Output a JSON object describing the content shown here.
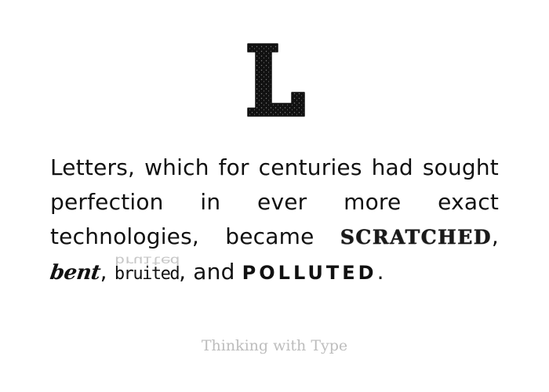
{
  "drop_cap": "L",
  "quote": {
    "part1": "Letters, which for centuries had sought perfection in ever more exact technologies, became ",
    "scratched": "SCRATCHED",
    "sep1": ", ",
    "bent": "bent",
    "sep2": ", ",
    "bruited": "bruited",
    "sep3": ", and ",
    "polluted": "POLLUTED",
    "end": "."
  },
  "footer": {
    "credit": "Thinking with Type"
  },
  "colors": {
    "text": "#111111",
    "credit": "#bdbdbd",
    "background": "#ffffff"
  }
}
